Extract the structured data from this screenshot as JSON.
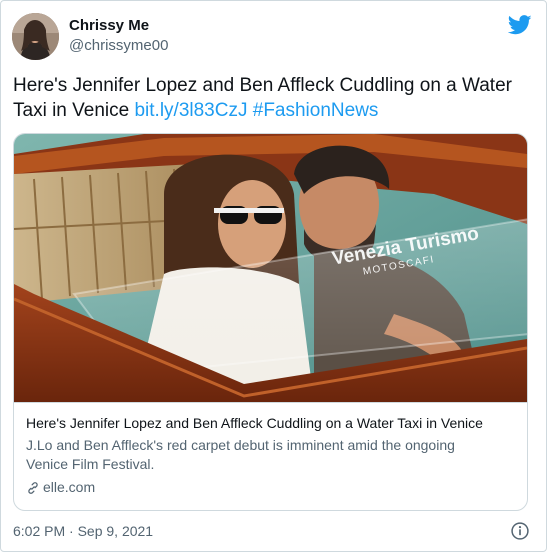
{
  "user": {
    "display_name": "Chrissy Me",
    "handle": "@chrissyme00"
  },
  "tweet": {
    "text_plain": "Here's Jennifer Lopez and Ben Affleck Cuddling on a Water Taxi in Venice",
    "link_url": "bit.ly/3l83CzJ",
    "hashtag": "#FashionNews",
    "timestamp": "6:02 PM · Sep 9, 2021"
  },
  "card": {
    "title": "Here's Jennifer Lopez and Ben Affleck Cuddling on a Water Taxi in Venice",
    "description": "J.Lo and Ben Affleck's red carpet debut is imminent amid the ongoing Venice Film Festival.",
    "domain": "elle.com",
    "watermark_line1": "Venezia Turismo",
    "watermark_line2": "MOTOSCAFI"
  },
  "icons": {
    "brand": "twitter-bird-icon",
    "link": "link-icon",
    "info": "info-icon"
  },
  "colors": {
    "accent": "#1d9bf0",
    "text_primary": "#0f1419",
    "text_secondary": "#536471",
    "border": "#cfd9de"
  }
}
